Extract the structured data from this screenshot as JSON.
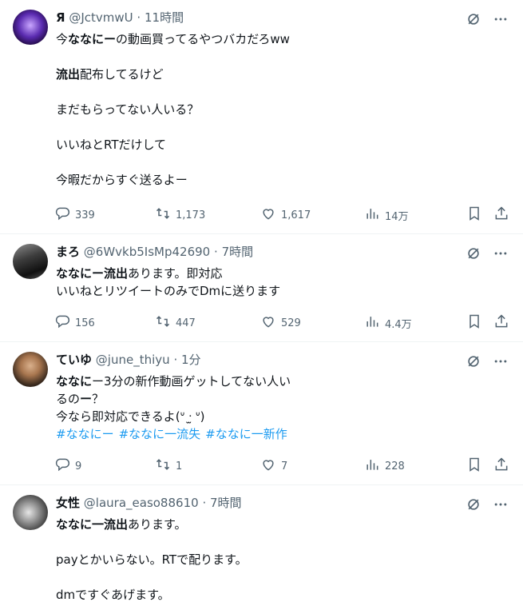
{
  "tweets": [
    {
      "name": "Я",
      "handle": "@JctvmwU",
      "time": "11時間",
      "lines": [
        {
          "parts": [
            {
              "t": "今"
            },
            {
              "t": "ななにー",
              "b": true
            },
            {
              "t": "の動画買ってるやつバカだろww"
            }
          ]
        },
        {
          "blank": true
        },
        {
          "parts": [
            {
              "t": "流出",
              "b": true
            },
            {
              "t": "配布してるけど"
            }
          ]
        },
        {
          "blank": true
        },
        {
          "parts": [
            {
              "t": "まだもらってない人いる？"
            }
          ]
        },
        {
          "blank": true
        },
        {
          "parts": [
            {
              "t": "いいねとRTだけして"
            }
          ]
        },
        {
          "blank": true
        },
        {
          "parts": [
            {
              "t": "今暇だからすぐ送るよー"
            }
          ]
        }
      ],
      "stats": {
        "replies": "339",
        "retweets": "1,173",
        "likes": "1,617",
        "views": "14万"
      }
    },
    {
      "name": "まろ",
      "handle": "@6Wvkb5IsMp42690",
      "time": "7時間",
      "lines": [
        {
          "parts": [
            {
              "t": "ななにー流出",
              "b": true
            },
            {
              "t": "あります。即対応"
            }
          ]
        },
        {
          "parts": [
            {
              "t": "いいねとリツイートのみでDmに送ります"
            }
          ]
        }
      ],
      "stats": {
        "replies": "156",
        "retweets": "447",
        "likes": "529",
        "views": "4.4万"
      }
    },
    {
      "name": "ていゆ",
      "handle": "@june_thiyu",
      "time": "1分",
      "lines": [
        {
          "parts": [
            {
              "t": "ななに",
              "b": true
            },
            {
              "t": "ー3分の新作動画ゲットしてない人い"
            }
          ]
        },
        {
          "parts": [
            {
              "t": "るの"
            },
            {
              "t": "ー",
              "b": true
            },
            {
              "t": "？"
            }
          ]
        },
        {
          "parts": [
            {
              "t": "今なら即対応できるよ(ᐡ ᐧ̫ ᐡ)"
            }
          ]
        }
      ],
      "hashtags": [
        "#ななにー",
        "#ななに一流失",
        "#ななに一新作"
      ],
      "stats": {
        "replies": "9",
        "retweets": "1",
        "likes": "7",
        "views": "228"
      }
    },
    {
      "name": "女性",
      "handle": "@laura_easo88610",
      "time": "7時間",
      "lines": [
        {
          "parts": [
            {
              "t": "ななに一流出",
              "b": true
            },
            {
              "t": "あります。"
            }
          ]
        },
        {
          "blank": true
        },
        {
          "parts": [
            {
              "t": "payとかいらない。RTで配ります。"
            }
          ]
        },
        {
          "blank": true
        },
        {
          "parts": [
            {
              "t": "dmですぐあげます。"
            }
          ]
        }
      ]
    }
  ],
  "icons": {
    "more": "more-icon",
    "grok": "grok-icon",
    "reply": "reply-icon",
    "retweet": "retweet-icon",
    "like": "like-icon",
    "views": "views-icon",
    "bookmark": "bookmark-icon",
    "share": "share-icon"
  },
  "colors": {
    "text": "#0f1419",
    "secondary": "#536471",
    "link": "#1d9bf0",
    "divider": "#eff3f4"
  }
}
